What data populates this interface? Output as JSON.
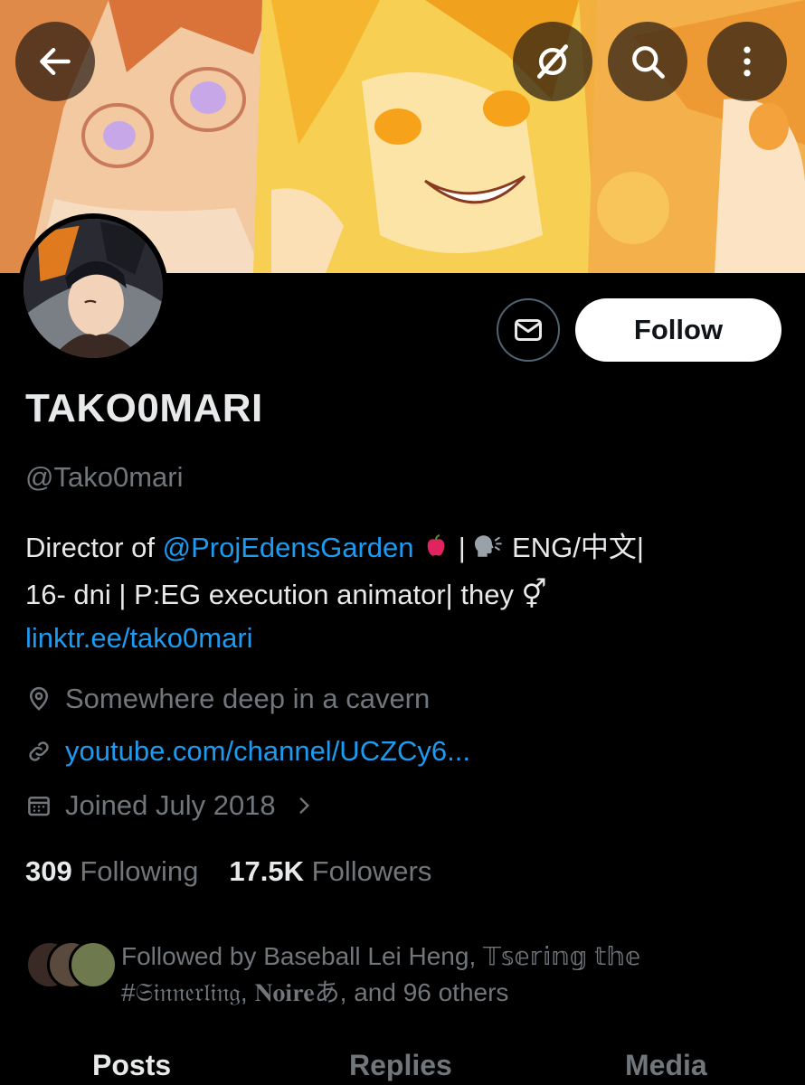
{
  "header": {
    "back_icon": "arrow-left-icon",
    "grok_icon": "grok-icon",
    "search_icon": "search-icon",
    "more_icon": "more-vertical-icon"
  },
  "profile": {
    "display_name": "TAKO0MARI",
    "handle": "@Tako0mari",
    "follow_label": "Follow",
    "message_icon": "envelope-icon",
    "bio": {
      "t1": "Director of ",
      "mention": "@ProjEdensGarden",
      "apple": "🍎",
      "t2": " | ",
      "speaking": "🗣",
      "t3": " ENG/中文|",
      "t4": "16- dni | P:EG execution animator| they ⚥ ",
      "link": "linktr.ee/tako0mari"
    },
    "location": "Somewhere deep in a cavern",
    "website": "youtube.com/channel/UCZCy6...",
    "joined": "Joined July 2018",
    "following_count": "309",
    "following_label": "Following",
    "followers_count": "17.5K",
    "followers_label": "Followers",
    "followed_by": {
      "prefix": "Followed by ",
      "names": "Baseball Lei Heng, 𝕋𝕤𝕖𝕣𝕚𝕟𝕘 𝕥𝕙𝕖",
      "line2": "#𝔖𝔦𝔫𝔫𝔢𝔯𝔩𝔦𝔫𝔤, 𝐍𝐨𝐢𝐫𝐞あ, and 96 others"
    }
  },
  "tabs": [
    {
      "label": "Posts"
    },
    {
      "label": "Replies"
    },
    {
      "label": "Media"
    }
  ],
  "colors": {
    "accent": "#1d9bf0",
    "secondary_text": "#71767b",
    "primary_text": "#e7e9ea",
    "background": "#000000"
  }
}
